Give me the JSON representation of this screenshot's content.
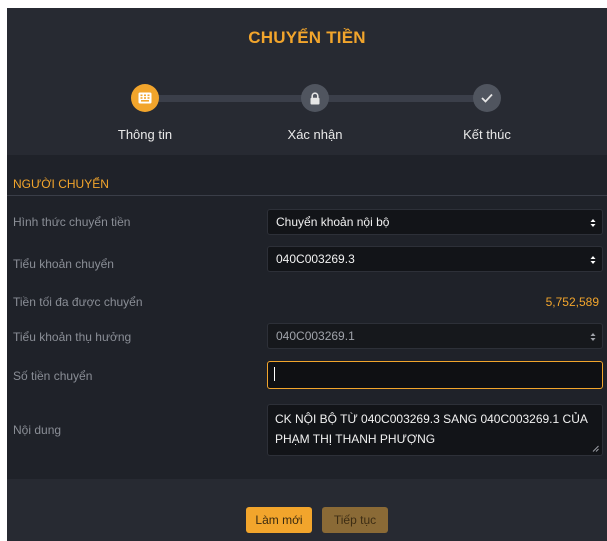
{
  "title": "CHUYỂN TIỀN",
  "steps": [
    {
      "label": "Thông tin",
      "icon": "keyboard-icon",
      "state": "active"
    },
    {
      "label": "Xác nhận",
      "icon": "lock-icon",
      "state": "pending"
    },
    {
      "label": "Kết thúc",
      "icon": "check-icon",
      "state": "pending"
    }
  ],
  "section": {
    "title": "NGƯỜI CHUYỂN"
  },
  "form": {
    "transfer_type": {
      "label": "Hình thức chuyển tiền",
      "value": "Chuyển khoản nội bộ"
    },
    "source_account": {
      "label": "Tiểu khoản chuyển",
      "value": "040C003269.3"
    },
    "max_amount": {
      "label": "Tiền tối đa được chuyển",
      "value": "5,752,589"
    },
    "beneficiary_account": {
      "label": "Tiểu khoản thụ hưởng",
      "value": "040C003269.1"
    },
    "amount": {
      "label": "Số tiền chuyển",
      "value": ""
    },
    "content": {
      "label": "Nội dung",
      "value": "CK NỘI BỘ TỪ 040C003269.3 SANG 040C003269.1 CỦA PHẠM THỊ THANH PHƯỢNG"
    }
  },
  "buttons": {
    "reset": "Làm mới",
    "next": "Tiếp tục"
  },
  "colors": {
    "accent": "#f2a52c",
    "panel": "#1f2229",
    "header": "#272a32",
    "field": "#121418"
  }
}
